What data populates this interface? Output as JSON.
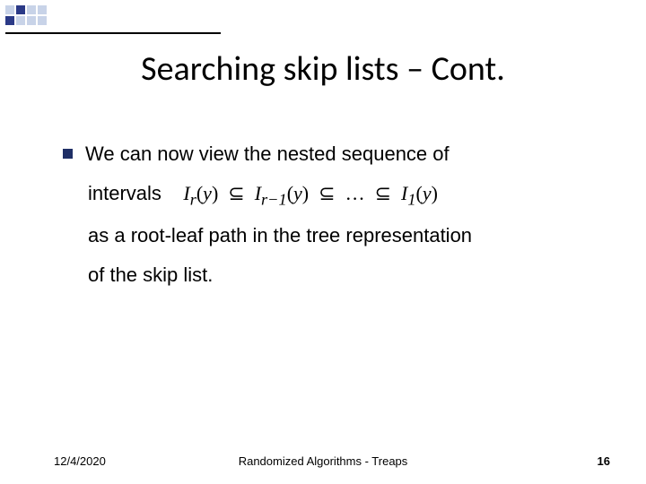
{
  "title": "Searching skip lists – Cont.",
  "body": {
    "line1": "We can now view the nested sequence of",
    "line2_prefix": "intervals",
    "line3": "as a root-leaf path in the tree representation",
    "line4": "of the skip list."
  },
  "formula": {
    "i": "I",
    "r": "r",
    "y": "y",
    "sub1": "r",
    "sub2": "r−1",
    "dots": "…",
    "subN": "1",
    "subset": "⊆"
  },
  "footer": {
    "date": "12/4/2020",
    "title": "Randomized Algorithms - Treaps",
    "page": "16"
  }
}
